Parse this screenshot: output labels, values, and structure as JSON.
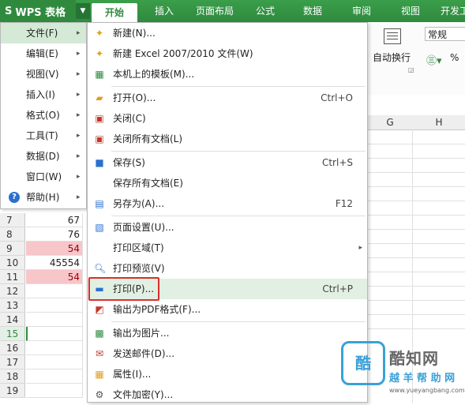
{
  "app": {
    "name": "WPS 表格",
    "logo": "S"
  },
  "tabs": [
    "开始",
    "插入",
    "页面布局",
    "公式",
    "数据",
    "审阅",
    "视图",
    "开发工"
  ],
  "ribbon": {
    "wrap_label": "自动换行",
    "number_format": "常规",
    "percent": "%"
  },
  "columns": [
    "G",
    "H"
  ],
  "rows": [
    {
      "num": "7",
      "value": "67",
      "pink": false
    },
    {
      "num": "8",
      "value": "76",
      "pink": false
    },
    {
      "num": "9",
      "value": "54",
      "pink": true
    },
    {
      "num": "10",
      "value": "45554",
      "pink": false
    },
    {
      "num": "11",
      "value": "54",
      "pink": true
    },
    {
      "num": "12",
      "value": "",
      "pink": false
    },
    {
      "num": "13",
      "value": "",
      "pink": false
    },
    {
      "num": "14",
      "value": "",
      "pink": false
    },
    {
      "num": "15",
      "value": "",
      "pink": false
    },
    {
      "num": "16",
      "value": "",
      "pink": false
    },
    {
      "num": "17",
      "value": "",
      "pink": false
    },
    {
      "num": "18",
      "value": "",
      "pink": false
    },
    {
      "num": "19",
      "value": "",
      "pink": false
    },
    {
      "num": "20",
      "value": "",
      "pink": false
    }
  ],
  "app_menu": [
    {
      "label": "文件(F)",
      "arrow": true
    },
    {
      "label": "编辑(E)",
      "arrow": true
    },
    {
      "label": "视图(V)",
      "arrow": true
    },
    {
      "label": "插入(I)",
      "arrow": true
    },
    {
      "label": "格式(O)",
      "arrow": true
    },
    {
      "label": "工具(T)",
      "arrow": true
    },
    {
      "label": "数据(D)",
      "arrow": true
    },
    {
      "label": "窗口(W)",
      "arrow": true
    },
    {
      "label": "帮助(H)",
      "arrow": true
    }
  ],
  "file_menu": [
    {
      "label": "新建(N)...",
      "shortcut": "",
      "icon": "new-icon"
    },
    {
      "label": "新建 Excel 2007/2010 文件(W)",
      "shortcut": "",
      "icon": "new-excel-icon"
    },
    {
      "label": "本机上的模板(M)...",
      "shortcut": "",
      "icon": "template-icon"
    },
    {
      "label": "打开(O)...",
      "shortcut": "Ctrl+O",
      "icon": "open-folder-icon"
    },
    {
      "label": "关闭(C)",
      "shortcut": "",
      "icon": "close-doc-icon"
    },
    {
      "label": "关闭所有文档(L)",
      "shortcut": "",
      "icon": "close-all-icon"
    },
    {
      "label": "保存(S)",
      "shortcut": "Ctrl+S",
      "icon": "save-icon"
    },
    {
      "label": "保存所有文档(E)",
      "shortcut": "",
      "icon": ""
    },
    {
      "label": "另存为(A)...",
      "shortcut": "F12",
      "icon": "save-as-icon"
    },
    {
      "label": "页面设置(U)...",
      "shortcut": "",
      "icon": "page-setup-icon"
    },
    {
      "label": "打印区域(T)",
      "shortcut": "",
      "icon": ""
    },
    {
      "label": "打印预览(V)",
      "shortcut": "",
      "icon": "print-preview-icon"
    },
    {
      "label": "打印(P)...",
      "shortcut": "Ctrl+P",
      "icon": "printer-icon"
    },
    {
      "label": "输出为PDF格式(F)...",
      "shortcut": "",
      "icon": "pdf-icon"
    },
    {
      "label": "输出为图片...",
      "shortcut": "",
      "icon": "image-icon"
    },
    {
      "label": "发送邮件(D)...",
      "shortcut": "",
      "icon": "mail-icon"
    },
    {
      "label": "属性(I)...",
      "shortcut": "",
      "icon": "properties-icon"
    },
    {
      "label": "文件加密(Y)...",
      "shortcut": "",
      "icon": "encrypt-icon"
    }
  ],
  "watermark": {
    "logo": "酷",
    "title": "酷知网",
    "subtitle": "越 羊 帮 助 网",
    "url": "www.yueyangbang.com"
  },
  "colors": {
    "brand_green": "#2f8a3e",
    "menu_highlight": "#e2efe3",
    "print_box": "#d9302c",
    "pink_cell": "#f7c6c9"
  }
}
